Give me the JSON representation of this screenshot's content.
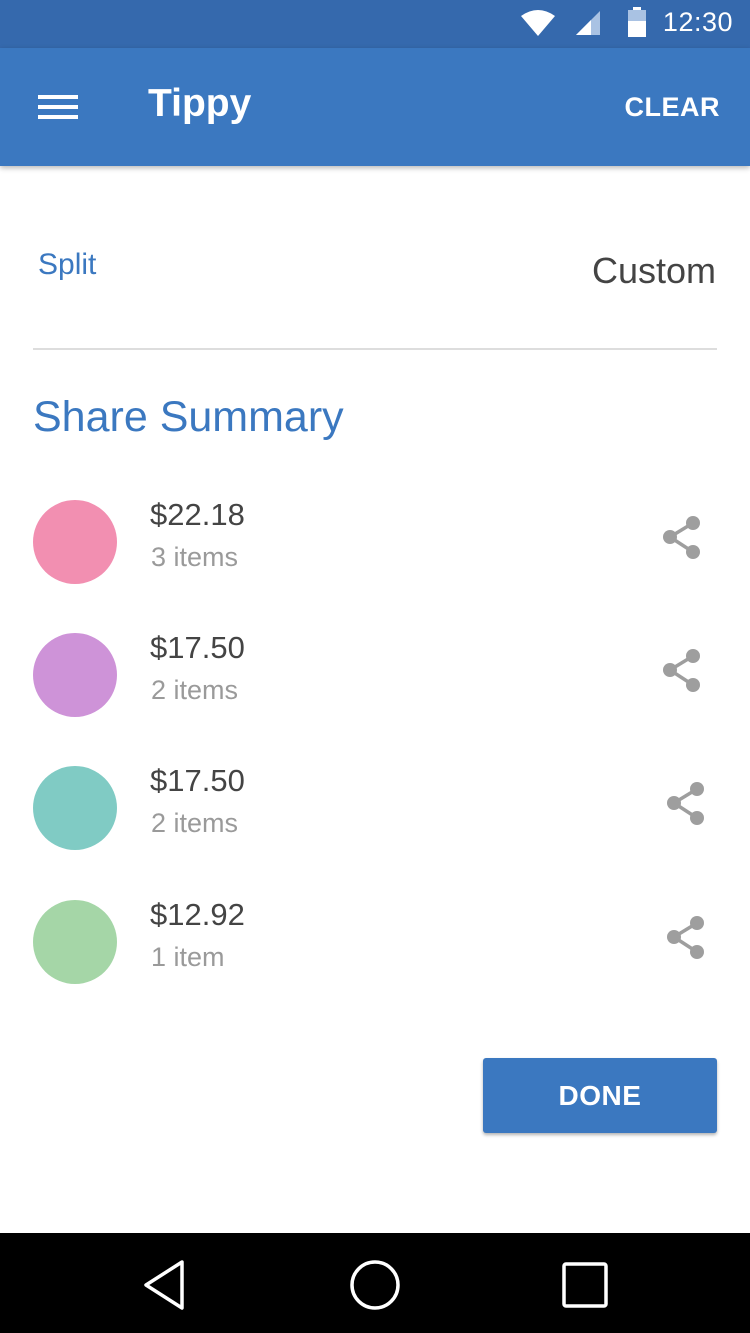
{
  "status_bar": {
    "time": "12:30",
    "icons": [
      "wifi-icon",
      "cell-signal-icon",
      "battery-icon"
    ]
  },
  "app_bar": {
    "title": "Tippy",
    "clear_label": "CLEAR",
    "menu_icon": "hamburger-menu-icon",
    "color": "#3b78c0"
  },
  "split": {
    "label": "Split",
    "value": "Custom"
  },
  "share_summary": {
    "title": "Share Summary",
    "rows": [
      {
        "amount": "$22.18",
        "items": "3 items",
        "color": "#f28fb1"
      },
      {
        "amount": "$17.50",
        "items": "2 items",
        "color": "#ce93d8"
      },
      {
        "amount": "$17.50",
        "items": "2 items",
        "color": "#80cbc4"
      },
      {
        "amount": "$12.92",
        "items": "1 item",
        "color": "#a5d6a7"
      }
    ],
    "share_icon": "share-icon"
  },
  "done_label": "DONE",
  "nav_bar": {
    "icons": [
      "back-icon",
      "home-icon",
      "recents-icon"
    ]
  }
}
